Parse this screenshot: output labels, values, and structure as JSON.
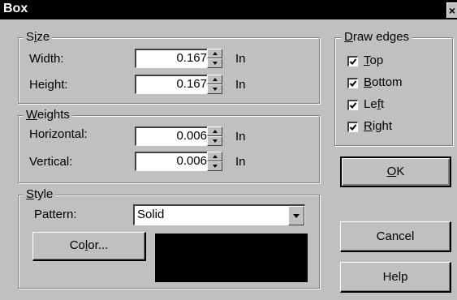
{
  "window": {
    "title": "Box",
    "close_glyph": "×"
  },
  "size_group": {
    "legend_first": "S",
    "legend_ul": "i",
    "legend_rest": "ze",
    "width_label": "Width:",
    "width_value": "0.167",
    "width_unit": "In",
    "height_label": "Height:",
    "height_value": "0.167",
    "height_unit": "In"
  },
  "weights_group": {
    "legend_ul": "W",
    "legend_rest": "eights",
    "horizontal_label": "Horizontal:",
    "horizontal_value": "0.006",
    "horizontal_unit": "In",
    "vertical_label": "Vertical:",
    "vertical_value": "0.006",
    "vertical_unit": "In"
  },
  "style_group": {
    "legend_ul": "S",
    "legend_rest": "tyle",
    "pattern_label": "Pattern:",
    "pattern_value": "Solid",
    "color_button_pre": "Co",
    "color_button_ul": "l",
    "color_button_post": "or...",
    "color_swatch": "#000000"
  },
  "draw_edges": {
    "legend_ul": "D",
    "legend_rest": "raw edges",
    "items": [
      {
        "ul": "T",
        "rest": "op",
        "checked": true
      },
      {
        "ul": "B",
        "rest": "ottom",
        "checked": true
      },
      {
        "pre": "Le",
        "ul": "f",
        "rest": "t",
        "checked": true
      },
      {
        "ul": "R",
        "rest": "ight",
        "checked": true
      }
    ]
  },
  "buttons": {
    "ok_ul": "O",
    "ok_rest": "K",
    "cancel": "Cancel",
    "help": "Help"
  }
}
